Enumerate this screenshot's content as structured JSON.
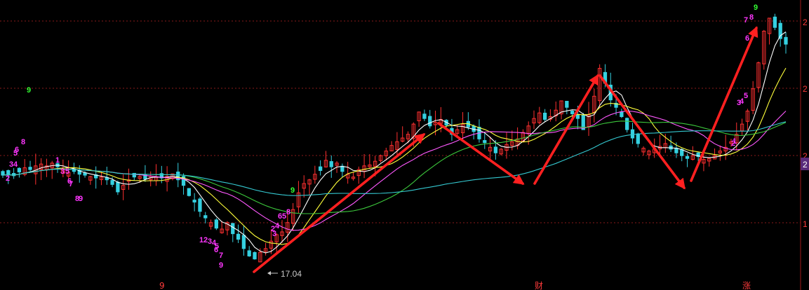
{
  "chart_data": {
    "type": "candlestick",
    "price_axis_ticks": [
      "2",
      "2",
      "2",
      "1"
    ],
    "current_price_badge": "2",
    "low_annotation": "17.04",
    "bottom_markers": [
      "9",
      "财",
      "涨"
    ],
    "colors": {
      "up": "#ff3030",
      "down": "#35d0e0",
      "ma5": "#ffffff",
      "ma10": "#ffff3a",
      "ma20": "#ff58ff",
      "ma30": "#3cc83c",
      "ma60": "#34c8d0",
      "trend_arrows": "#ff2020",
      "grid": "#8a1a1a",
      "count_labels": "#ff36ff",
      "nine_label": "#33ff33"
    },
    "close_path": [
      21.55,
      21.6,
      21.52,
      21.72,
      21.95,
      21.85,
      22.05,
      22.15,
      22.05,
      22.2,
      22.0,
      21.85,
      21.7,
      21.75,
      21.6,
      21.55,
      21.48,
      21.4,
      21.45,
      21.3,
      21.05,
      20.65,
      21.0,
      21.3,
      21.45,
      21.48,
      21.35,
      21.5,
      21.45,
      21.4,
      21.48,
      21.62,
      21.3,
      21.0,
      20.45,
      20.1,
      19.6,
      19.25,
      19.0,
      18.7,
      18.65,
      19.0,
      18.4,
      18.1,
      17.6,
      17.2,
      17.04,
      17.4,
      17.6,
      18.0,
      18.35,
      18.5,
      19.0,
      19.7,
      20.6,
      21.1,
      21.3,
      21.6,
      21.8,
      22.35,
      22.0,
      22.2,
      21.75,
      21.6,
      21.45,
      21.85,
      22.05,
      22.1,
      22.3,
      22.6,
      22.85,
      23.15,
      23.35,
      23.55,
      23.75,
      24.3,
      24.95,
      24.6,
      24.2,
      24.4,
      24.55,
      24.25,
      23.75,
      24.0,
      24.3,
      24.15,
      23.9,
      23.5,
      23.3,
      23.05,
      22.75,
      22.95,
      23.2,
      23.35,
      23.5,
      23.85,
      24.2,
      24.6,
      24.9,
      24.55,
      24.7,
      25.05,
      25.55,
      25.2,
      24.85,
      24.6,
      24.0,
      24.8,
      25.8,
      27.3,
      26.5,
      25.6,
      25.2,
      24.7,
      24.0,
      23.55,
      23.25,
      23.0,
      22.85,
      22.95,
      23.1,
      23.25,
      22.95,
      22.75,
      22.6,
      22.45,
      22.6,
      22.55,
      22.4,
      22.45,
      22.6,
      22.85,
      23.05,
      23.35,
      23.75,
      24.3,
      25.0,
      26.2,
      27.6,
      29.3,
      30.0,
      29.5,
      28.9,
      28.6
    ]
  }
}
